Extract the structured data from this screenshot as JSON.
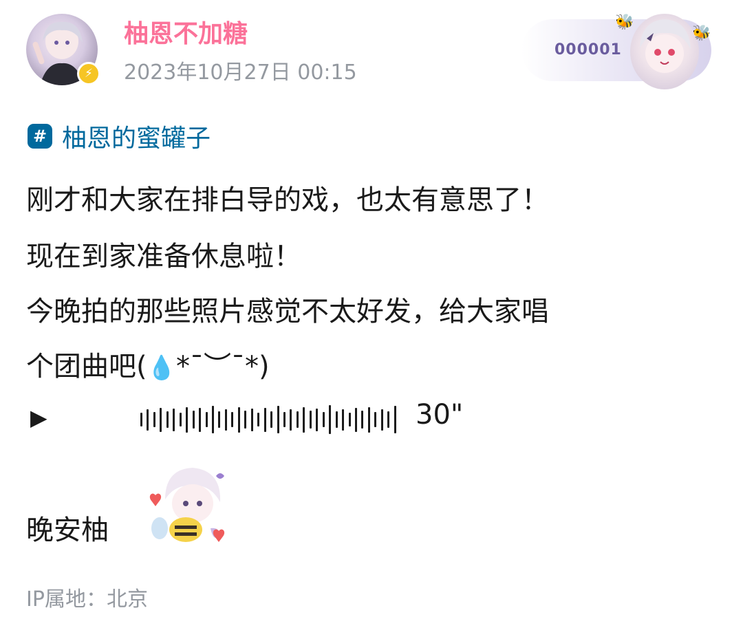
{
  "author": {
    "name": "柚恩不加糖",
    "timestamp": "2023年10月27日 00:15",
    "avatar_icon": "anime-avatar",
    "badge_icon": "lightning-icon",
    "badge_color": "#f6c524",
    "name_color": "#fb7299"
  },
  "fan_card": {
    "number": "000001",
    "number_color": "#6a5c9e",
    "sticker_icon": "anime-girl-sticker"
  },
  "topic": {
    "icon": "hashtag-icon",
    "label": "柚恩的蜜罐子",
    "color": "#00699d"
  },
  "content": {
    "lines": [
      "刚才和大家在排白导的戏，也太有意思了！",
      "现在到家准备休息啦！",
      "今晚拍的那些照片感觉不太好发，给大家唱",
      "个团曲吧("
    ],
    "emoji": "💧",
    "kaomoji_tail": "*¯︶¯*)"
  },
  "voice_message": {
    "play_icon": "▶",
    "duration": "30\"",
    "waveform_levels": [
      0.45,
      0.7,
      0.5,
      0.8,
      0.55,
      0.75,
      0.45,
      0.85,
      0.6,
      0.8,
      0.5,
      0.9,
      0.55,
      0.7,
      0.5,
      0.85,
      0.6,
      0.75,
      0.45,
      0.8,
      0.55,
      0.9,
      0.5,
      0.7,
      0.55,
      0.85,
      0.6,
      0.75,
      0.5,
      0.95,
      0.55,
      0.7,
      0.45,
      0.8,
      0.6,
      0.85,
      0.5,
      0.7,
      0.55,
      0.9
    ]
  },
  "closing": {
    "text": "晚安柚",
    "sticker_icon": "bee-hug-sticker"
  },
  "ip_location": "IP属地：北京"
}
